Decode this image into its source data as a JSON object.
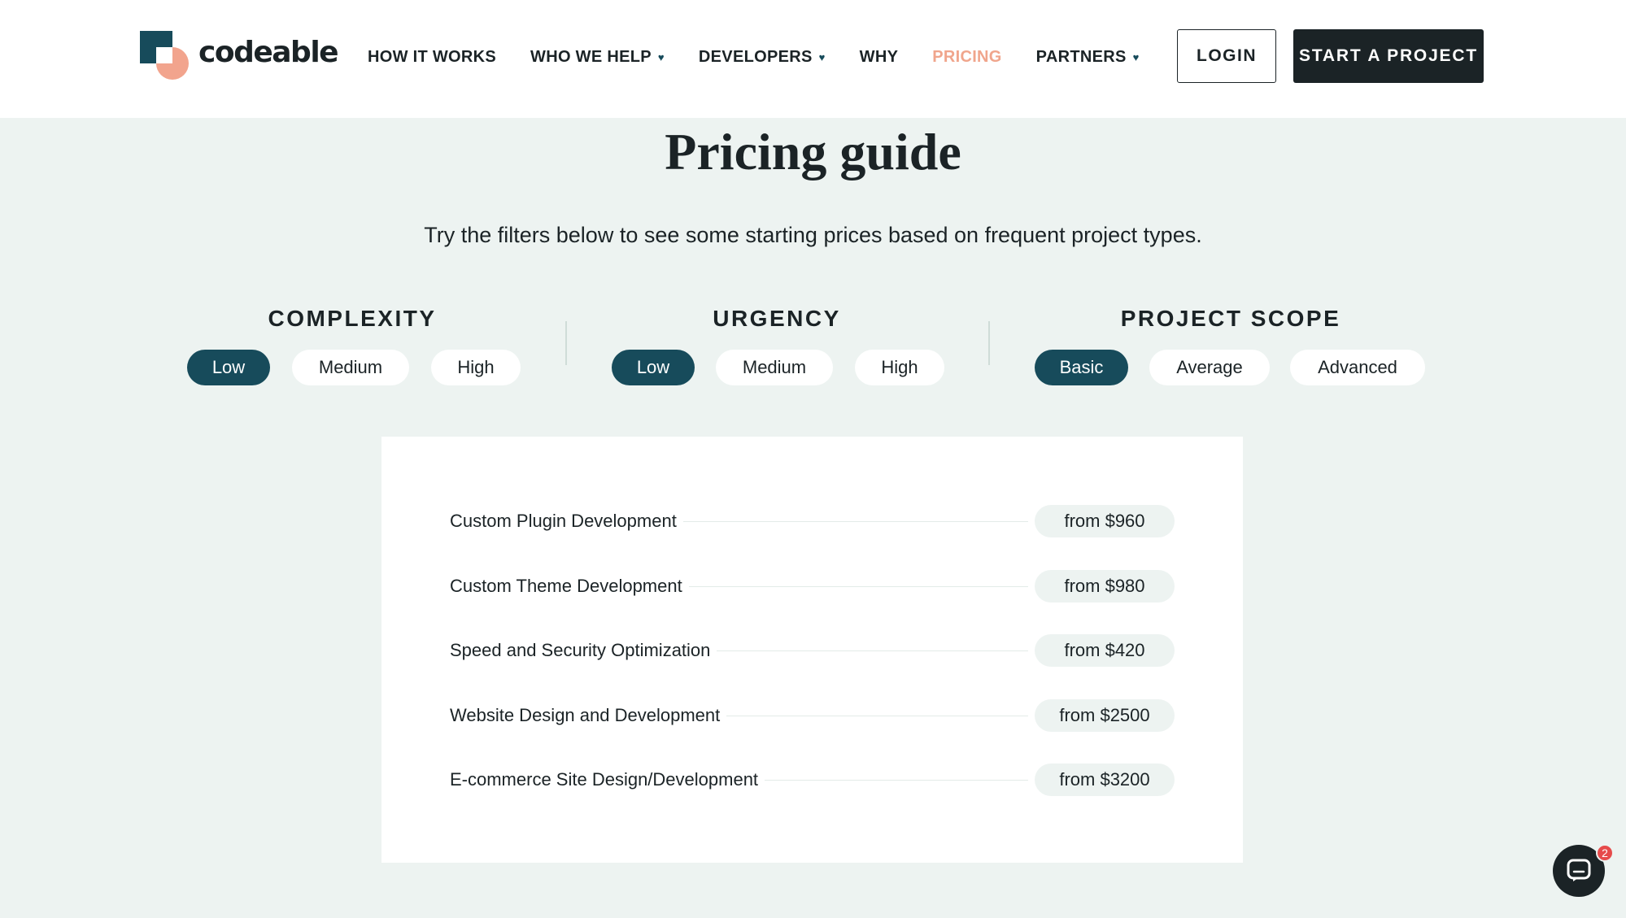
{
  "brand": {
    "name": "codeable"
  },
  "nav": {
    "items": [
      {
        "label": "HOW IT WORKS",
        "has_dropdown": false,
        "active": false
      },
      {
        "label": "WHO WE HELP",
        "has_dropdown": true,
        "active": false
      },
      {
        "label": "DEVELOPERS",
        "has_dropdown": true,
        "active": false
      },
      {
        "label": "WHY",
        "has_dropdown": false,
        "active": false
      },
      {
        "label": "PRICING",
        "has_dropdown": false,
        "active": true
      },
      {
        "label": "PARTNERS",
        "has_dropdown": true,
        "active": false
      }
    ],
    "caret": "♥",
    "login_label": "LOGIN",
    "start_label": "START A PROJECT"
  },
  "hero": {
    "title": "Pricing guide",
    "subtitle": "Try the filters below to see some starting prices based on frequent project types."
  },
  "filters": [
    {
      "title": "COMPLEXITY",
      "options": [
        "Low",
        "Medium",
        "High"
      ],
      "selected": "Low"
    },
    {
      "title": "URGENCY",
      "options": [
        "Low",
        "Medium",
        "High"
      ],
      "selected": "Low"
    },
    {
      "title": "PROJECT SCOPE",
      "options": [
        "Basic",
        "Average",
        "Advanced"
      ],
      "selected": "Basic"
    }
  ],
  "pricing": {
    "rows": [
      {
        "label": "Custom Plugin Development",
        "price": "from $960"
      },
      {
        "label": "Custom Theme Development",
        "price": "from $980"
      },
      {
        "label": "Speed and Security Optimization",
        "price": "from $420"
      },
      {
        "label": "Website Design and Development",
        "price": "from $2500"
      },
      {
        "label": "E-commerce Site Design/Development",
        "price": "from $3200"
      }
    ]
  },
  "chat": {
    "icon": "chat-icon",
    "badge": "2"
  },
  "colors": {
    "accent": "#174b5b",
    "active_nav": "#f0a58c",
    "background": "#edf3f1",
    "dark": "#1b2326"
  }
}
